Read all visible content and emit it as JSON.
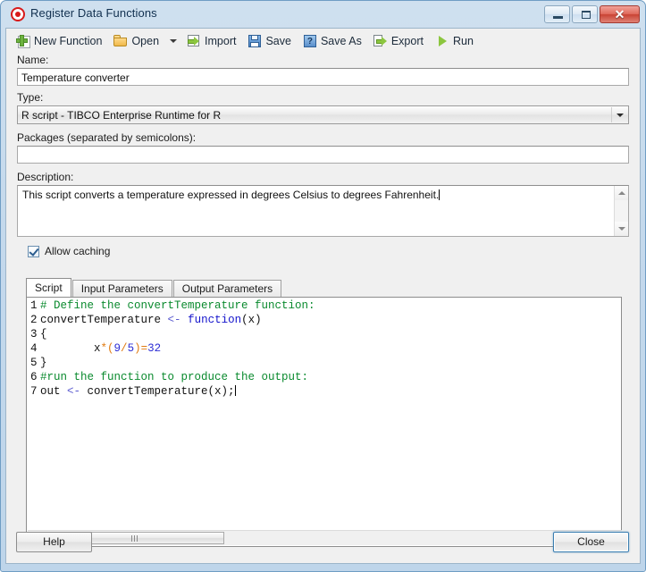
{
  "window": {
    "title": "Register Data Functions",
    "icon": "spotfire-target-icon",
    "controls": {
      "minimize": "minimize-icon",
      "maximize": "maximize-icon",
      "close": "✕"
    }
  },
  "toolbar": {
    "items": [
      {
        "label": "New Function",
        "icon": "new-function-icon"
      },
      {
        "label": "Open",
        "icon": "open-folder-icon",
        "has_dropdown": true
      },
      {
        "label": "Import",
        "icon": "import-icon"
      },
      {
        "label": "Save",
        "icon": "save-floppy-icon"
      },
      {
        "label": "Save As",
        "icon": "save-as-icon",
        "glyph": "?"
      },
      {
        "label": "Export",
        "icon": "export-icon"
      },
      {
        "label": "Run",
        "icon": "run-play-icon"
      }
    ]
  },
  "form": {
    "name_label": "Name:",
    "name_value": "Temperature converter",
    "name_placeholder": "",
    "type_label": "Type:",
    "type_value": "R script - TIBCO Enterprise Runtime for R",
    "packages_label": "Packages (separated by semicolons):",
    "packages_value": "",
    "packages_placeholder": "",
    "description_label": "Description:",
    "description_value": "This script converts a temperature expressed in degrees Celsius to degrees Fahrenheit.",
    "allow_caching_label": "Allow caching",
    "allow_caching_checked": true
  },
  "tabs": [
    {
      "label": "Script",
      "active": true
    },
    {
      "label": "Input Parameters",
      "active": false
    },
    {
      "label": "Output Parameters",
      "active": false
    }
  ],
  "script": {
    "lines": [
      {
        "n": "1",
        "tokens": [
          {
            "t": "# Define the convertTemperature function:",
            "c": "c-com"
          }
        ]
      },
      {
        "n": "2",
        "tokens": [
          {
            "t": "convertTemperature ",
            "c": "src"
          },
          {
            "t": "<-",
            "c": "c-asn"
          },
          {
            "t": " ",
            "c": "src"
          },
          {
            "t": "function",
            "c": "c-kw"
          },
          {
            "t": "(x)",
            "c": "src"
          }
        ]
      },
      {
        "n": "3",
        "tokens": [
          {
            "t": "{",
            "c": "src"
          }
        ]
      },
      {
        "n": "4",
        "tokens": [
          {
            "t": "        x",
            "c": "src"
          },
          {
            "t": "*(",
            "c": "c-op"
          },
          {
            "t": "9",
            "c": "c-num"
          },
          {
            "t": "/",
            "c": "c-op"
          },
          {
            "t": "5",
            "c": "c-num"
          },
          {
            "t": ")=",
            "c": "c-op"
          },
          {
            "t": "32",
            "c": "c-num"
          }
        ]
      },
      {
        "n": "5",
        "tokens": [
          {
            "t": "}",
            "c": "src"
          }
        ]
      },
      {
        "n": "6",
        "tokens": [
          {
            "t": "#run the function to produce the output:",
            "c": "c-com"
          }
        ]
      },
      {
        "n": "7",
        "tokens": [
          {
            "t": "out ",
            "c": "src"
          },
          {
            "t": "<-",
            "c": "c-asn"
          },
          {
            "t": " convertTemperature(x);",
            "c": "src"
          }
        ]
      }
    ],
    "colors": {
      "comment": "#0a8a2e",
      "keyword": "#1414cc",
      "operator": "#e07b12",
      "number": "#2d2dd4",
      "text": "#111111"
    }
  },
  "footer": {
    "help_label": "Help",
    "close_label": "Close"
  }
}
